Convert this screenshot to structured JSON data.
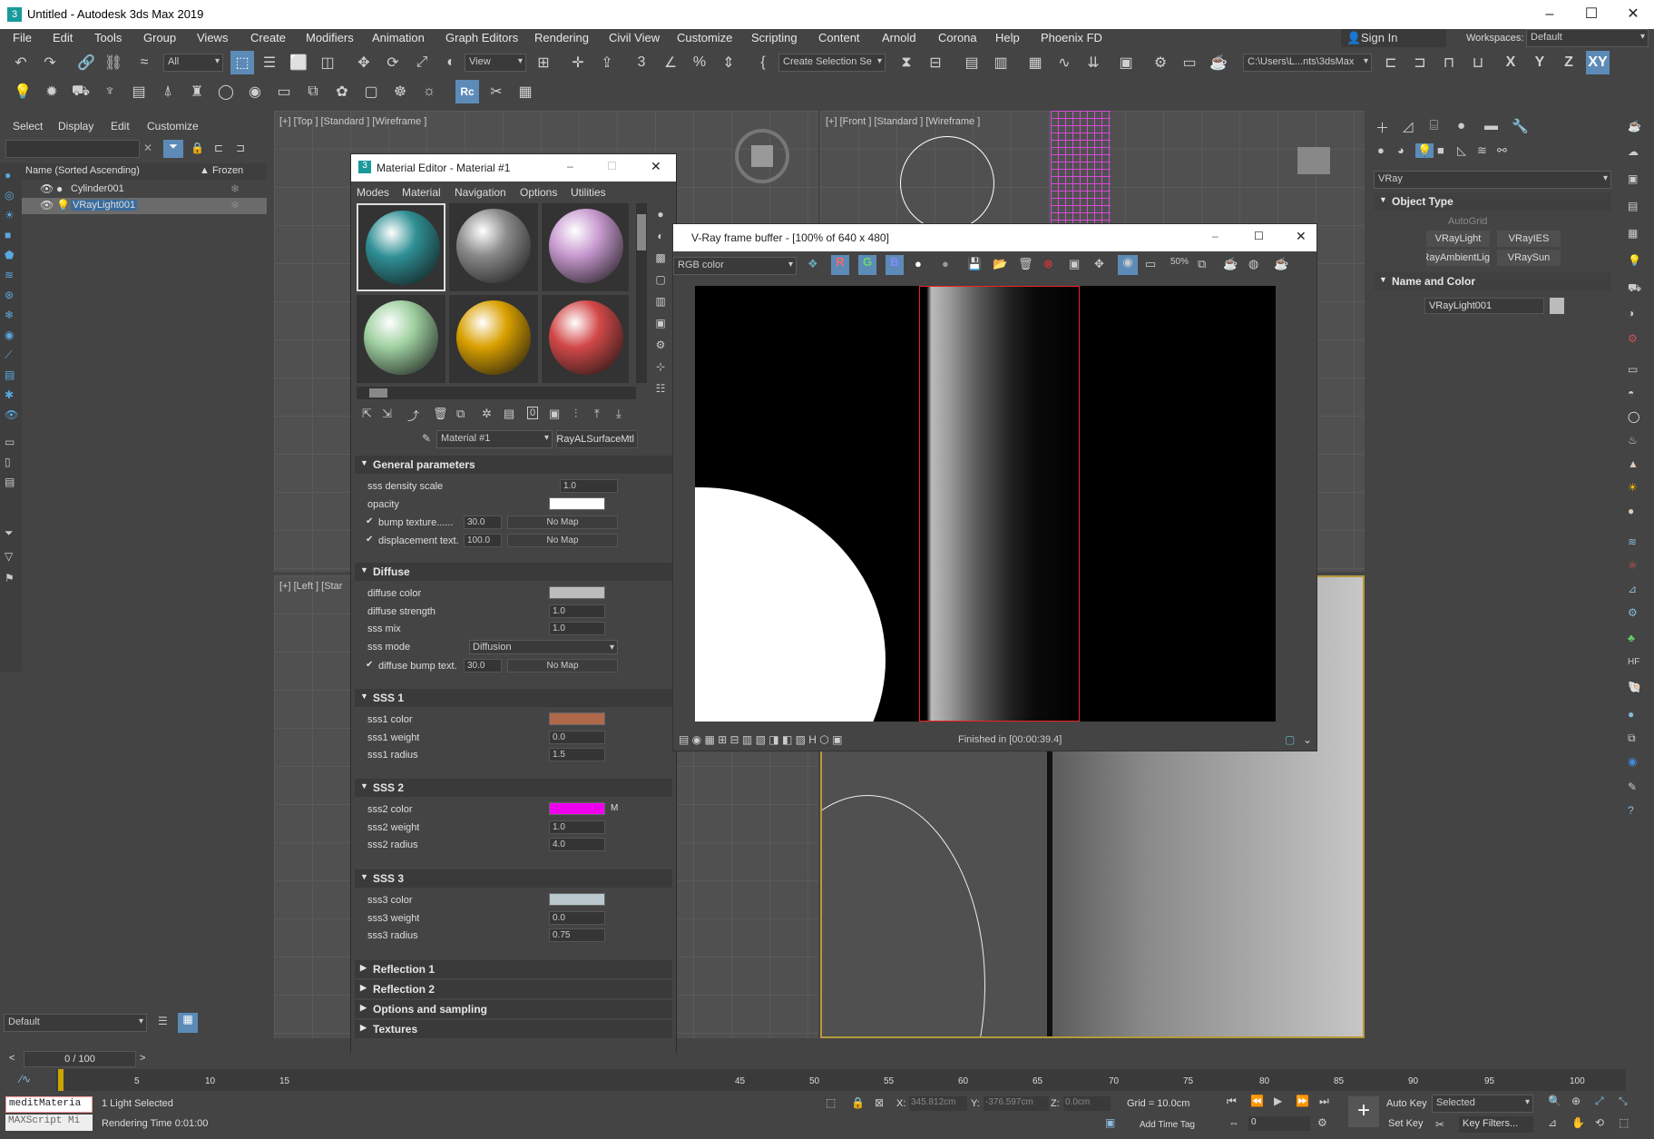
{
  "app": {
    "title": "Untitled - Autodesk 3ds Max 2019"
  },
  "menu": [
    "File",
    "Edit",
    "Tools",
    "Group",
    "Views",
    "Create",
    "Modifiers",
    "Animation",
    "Graph Editors",
    "Rendering",
    "Civil View",
    "Customize",
    "Scripting",
    "Content",
    "Arnold",
    "Corona",
    "Help",
    "Phoenix FD"
  ],
  "signin": "Sign In",
  "workspaces_label": "Workspaces:",
  "workspace_value": "Default",
  "toolbar": {
    "filter": "All",
    "view": "View",
    "sel_set": "Create Selection Se",
    "path": "C:\\Users\\L...nts\\3dsMax",
    "axes": [
      "X",
      "Y",
      "Z",
      "XY"
    ]
  },
  "scene": {
    "tabs": [
      "Select",
      "Display",
      "Edit",
      "Customize"
    ],
    "col_name": "Name (Sorted Ascending)",
    "col_frozen": "▲ Frozen",
    "items": [
      "Cylinder001",
      "VRayLight001"
    ]
  },
  "viewports": {
    "top": "[+] [Top ] [Standard ] [Wireframe ]",
    "front": "[+] [Front ] [Standard ] [Wireframe ]",
    "left": "[+] [Left ] [Star"
  },
  "layer": "Default",
  "timeline": {
    "counter": "0 / 100",
    "ticks": [
      "5",
      "10",
      "15",
      "45",
      "50",
      "55",
      "60",
      "65",
      "70",
      "75",
      "80",
      "85",
      "90",
      "95",
      "100"
    ]
  },
  "medit": {
    "title": "Material Editor - Material #1",
    "menu": [
      "Modes",
      "Material",
      "Navigation",
      "Options",
      "Utilities"
    ],
    "mat_name": "Material #1",
    "mat_type": "VRayALSurfaceMtl",
    "sphere_colors": [
      "#2e8f94",
      "#8a8a8a",
      "#c89ad0",
      "#9fd0a0",
      "#d9a000",
      "#d24848"
    ],
    "general": {
      "title": "General parameters",
      "sss_density": "sss density scale",
      "sss_density_val": "1.0",
      "opacity": "opacity",
      "bump": "bump texture......",
      "bump_val": "30.0",
      "disp": "displacement text.",
      "disp_val": "100.0",
      "nomap": "No Map"
    },
    "diffuse": {
      "title": "Diffuse",
      "color": "diffuse color",
      "strength": "diffuse strength",
      "strength_val": "1.0",
      "sssmix": "sss mix",
      "sssmix_val": "1.0",
      "mode": "sss mode",
      "mode_val": "Diffusion",
      "bump": "diffuse bump text.",
      "bump_val": "30.0"
    },
    "sss1": {
      "title": "SSS 1",
      "color": "sss1 color",
      "weight": "sss1 weight",
      "weight_val": "0.0",
      "radius": "sss1 radius",
      "radius_val": "1.5",
      "c": "#b0684a"
    },
    "sss2": {
      "title": "SSS 2",
      "color": "sss2 color",
      "weight": "sss2 weight",
      "weight_val": "1.0",
      "radius": "sss2 radius",
      "radius_val": "4.0",
      "c": "#ee00ee",
      "m": "M"
    },
    "sss3": {
      "title": "SSS 3",
      "color": "sss3 color",
      "weight": "sss3 weight",
      "weight_val": "0.0",
      "radius": "sss3 radius",
      "radius_val": "0.75",
      "c": "#b8c8cc"
    },
    "more": [
      "Reflection 1",
      "Reflection 2",
      "Options and sampling",
      "Textures"
    ]
  },
  "vfb": {
    "title": "V-Ray frame buffer - [100% of 640 x 480]",
    "channel": "RGB color",
    "status": "Finished in [00:00:39.4]"
  },
  "cmdpanel": {
    "renderer": "VRay",
    "objtype": "Object Type",
    "autogrid": "AutoGrid",
    "buttons": [
      "VRayLight",
      "VRayIES",
      "VRayAmbientLig",
      "VRaySun"
    ],
    "namecolor": "Name and Color",
    "objname": "VRayLight001"
  },
  "statusbar": {
    "macro1": "meditMateria",
    "macro2": "MAXScript Mi",
    "sel": "1 Light Selected",
    "rtime": "Rendering Time  0:01:00",
    "x": "345.812cm",
    "y": "-376.597cm",
    "z": "0.0cm",
    "grid": "Grid = 10.0cm",
    "addtag": "Add Time Tag",
    "autokey": "Auto Key",
    "setkey": "Set Key",
    "selected": "Selected",
    "keyfilters": "Key Filters...",
    "frame": "0"
  }
}
